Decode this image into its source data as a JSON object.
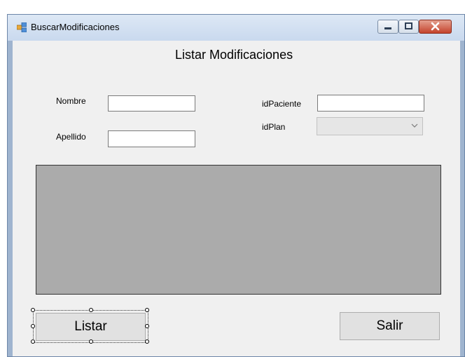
{
  "window": {
    "title": "BuscarModificaciones"
  },
  "form": {
    "heading": "Listar Modificaciones",
    "labels": {
      "nombre": "Nombre",
      "apellido": "Apellido",
      "idPaciente": "idPaciente",
      "idPlan": "idPlan"
    },
    "fields": {
      "nombre": "",
      "apellido": "",
      "idPaciente": "",
      "idPlan_selected": ""
    },
    "buttons": {
      "listar": "Listar",
      "salir": "Salir"
    }
  },
  "icons": {
    "app": "form-window-icon",
    "minimize": "minimize-icon",
    "maximize": "maximize-icon",
    "close": "close-icon",
    "dropdown": "chevron-down-icon"
  }
}
